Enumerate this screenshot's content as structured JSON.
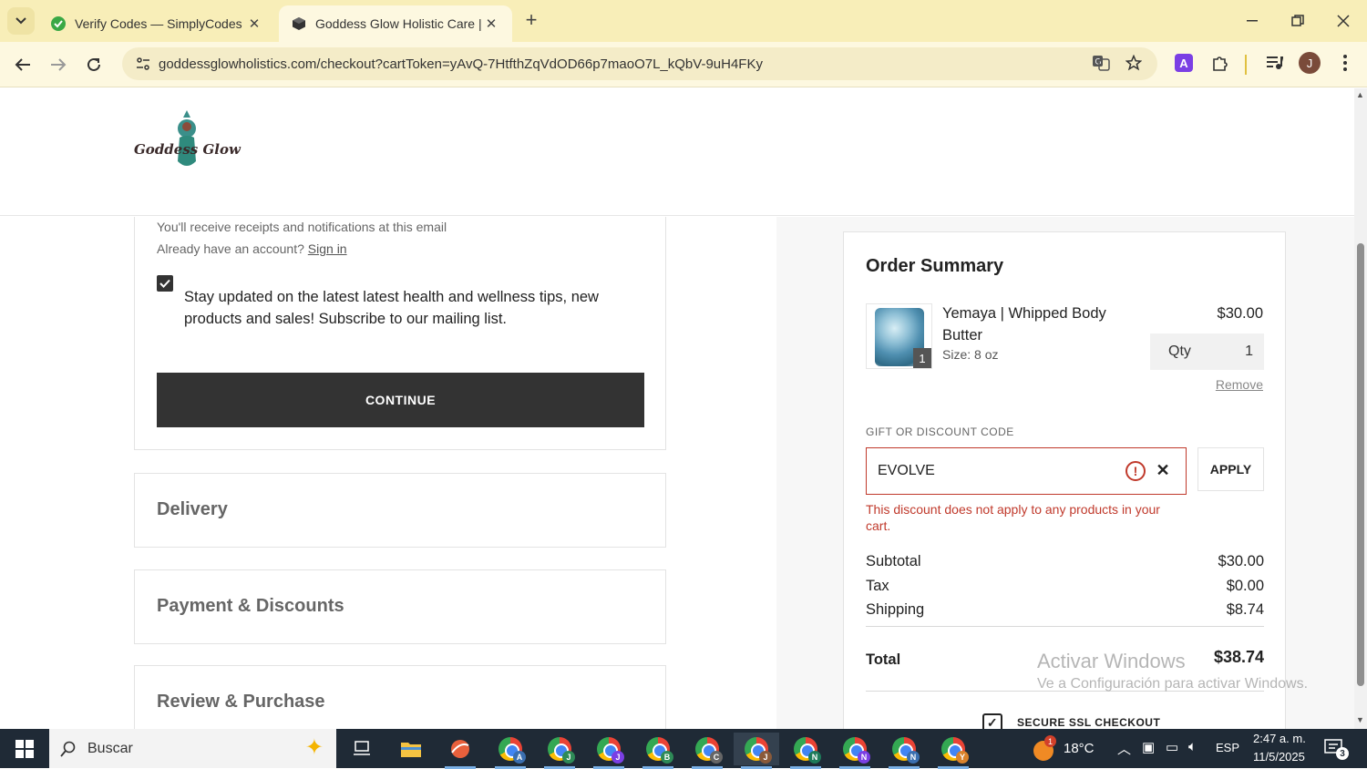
{
  "browser": {
    "tabs": [
      {
        "title": "Verify Codes — SimplyCodes",
        "active": false
      },
      {
        "title": "Goddess Glow Holistic Care | Se",
        "active": true
      }
    ],
    "url": "goddessglowholistics.com/checkout?cartToken=yAvQ-7HtfthZqVdOD66p7maoO7L_kQbV-9uH4FKy",
    "profile_initial": "J",
    "extension_letter": "A"
  },
  "header": {
    "logo_text": "Goddess Glow"
  },
  "contact": {
    "receipt_note": "You'll receive receipts and notifications at this email",
    "account_prompt": "Already have an account?",
    "sign_in_label": "Sign in",
    "newsletter_checked": true,
    "newsletter_text": "Stay updated on the latest latest health and wellness tips, new products and sales! Subscribe to our mailing list.",
    "continue_label": "CONTINUE"
  },
  "steps": [
    {
      "title": "Delivery"
    },
    {
      "title": "Payment & Discounts"
    },
    {
      "title": "Review & Purchase"
    }
  ],
  "summary": {
    "title": "Order Summary",
    "item": {
      "name": "Yemaya | Whipped Body Butter",
      "size": "Size: 8 oz",
      "price": "$30.00",
      "qty_label": "Qty",
      "qty": "1",
      "badge": "1",
      "remove_label": "Remove"
    },
    "discount": {
      "label": "GIFT OR DISCOUNT CODE",
      "value": "EVOLVE",
      "apply_label": "APPLY",
      "error": "This discount does not apply to any products in your cart."
    },
    "subtotal_label": "Subtotal",
    "subtotal": "$30.00",
    "tax_label": "Tax",
    "tax": "$0.00",
    "shipping_label": "Shipping",
    "shipping": "$8.74",
    "total_label": "Total",
    "total": "$38.74",
    "ssl_label": "SECURE SSL CHECKOUT"
  },
  "watermark": {
    "line1": "Activar Windows",
    "line2": "Ve a Configuración para activar Windows."
  },
  "taskbar": {
    "search_placeholder": "Buscar",
    "chrome_badges": [
      "A",
      "J",
      "J",
      "B",
      "C",
      "J",
      "N",
      "N",
      "N",
      "Y"
    ],
    "weather_temp": "18°C",
    "weather_badge": "1",
    "language": "ESP",
    "time": "2:47 a. m.",
    "date": "11/5/2025",
    "notification_count": "3"
  },
  "colors": {
    "tab_strip": "#f8eeb8",
    "button_dark": "#333333",
    "error_red": "#c0392b",
    "taskbar": "#1f2a36"
  }
}
